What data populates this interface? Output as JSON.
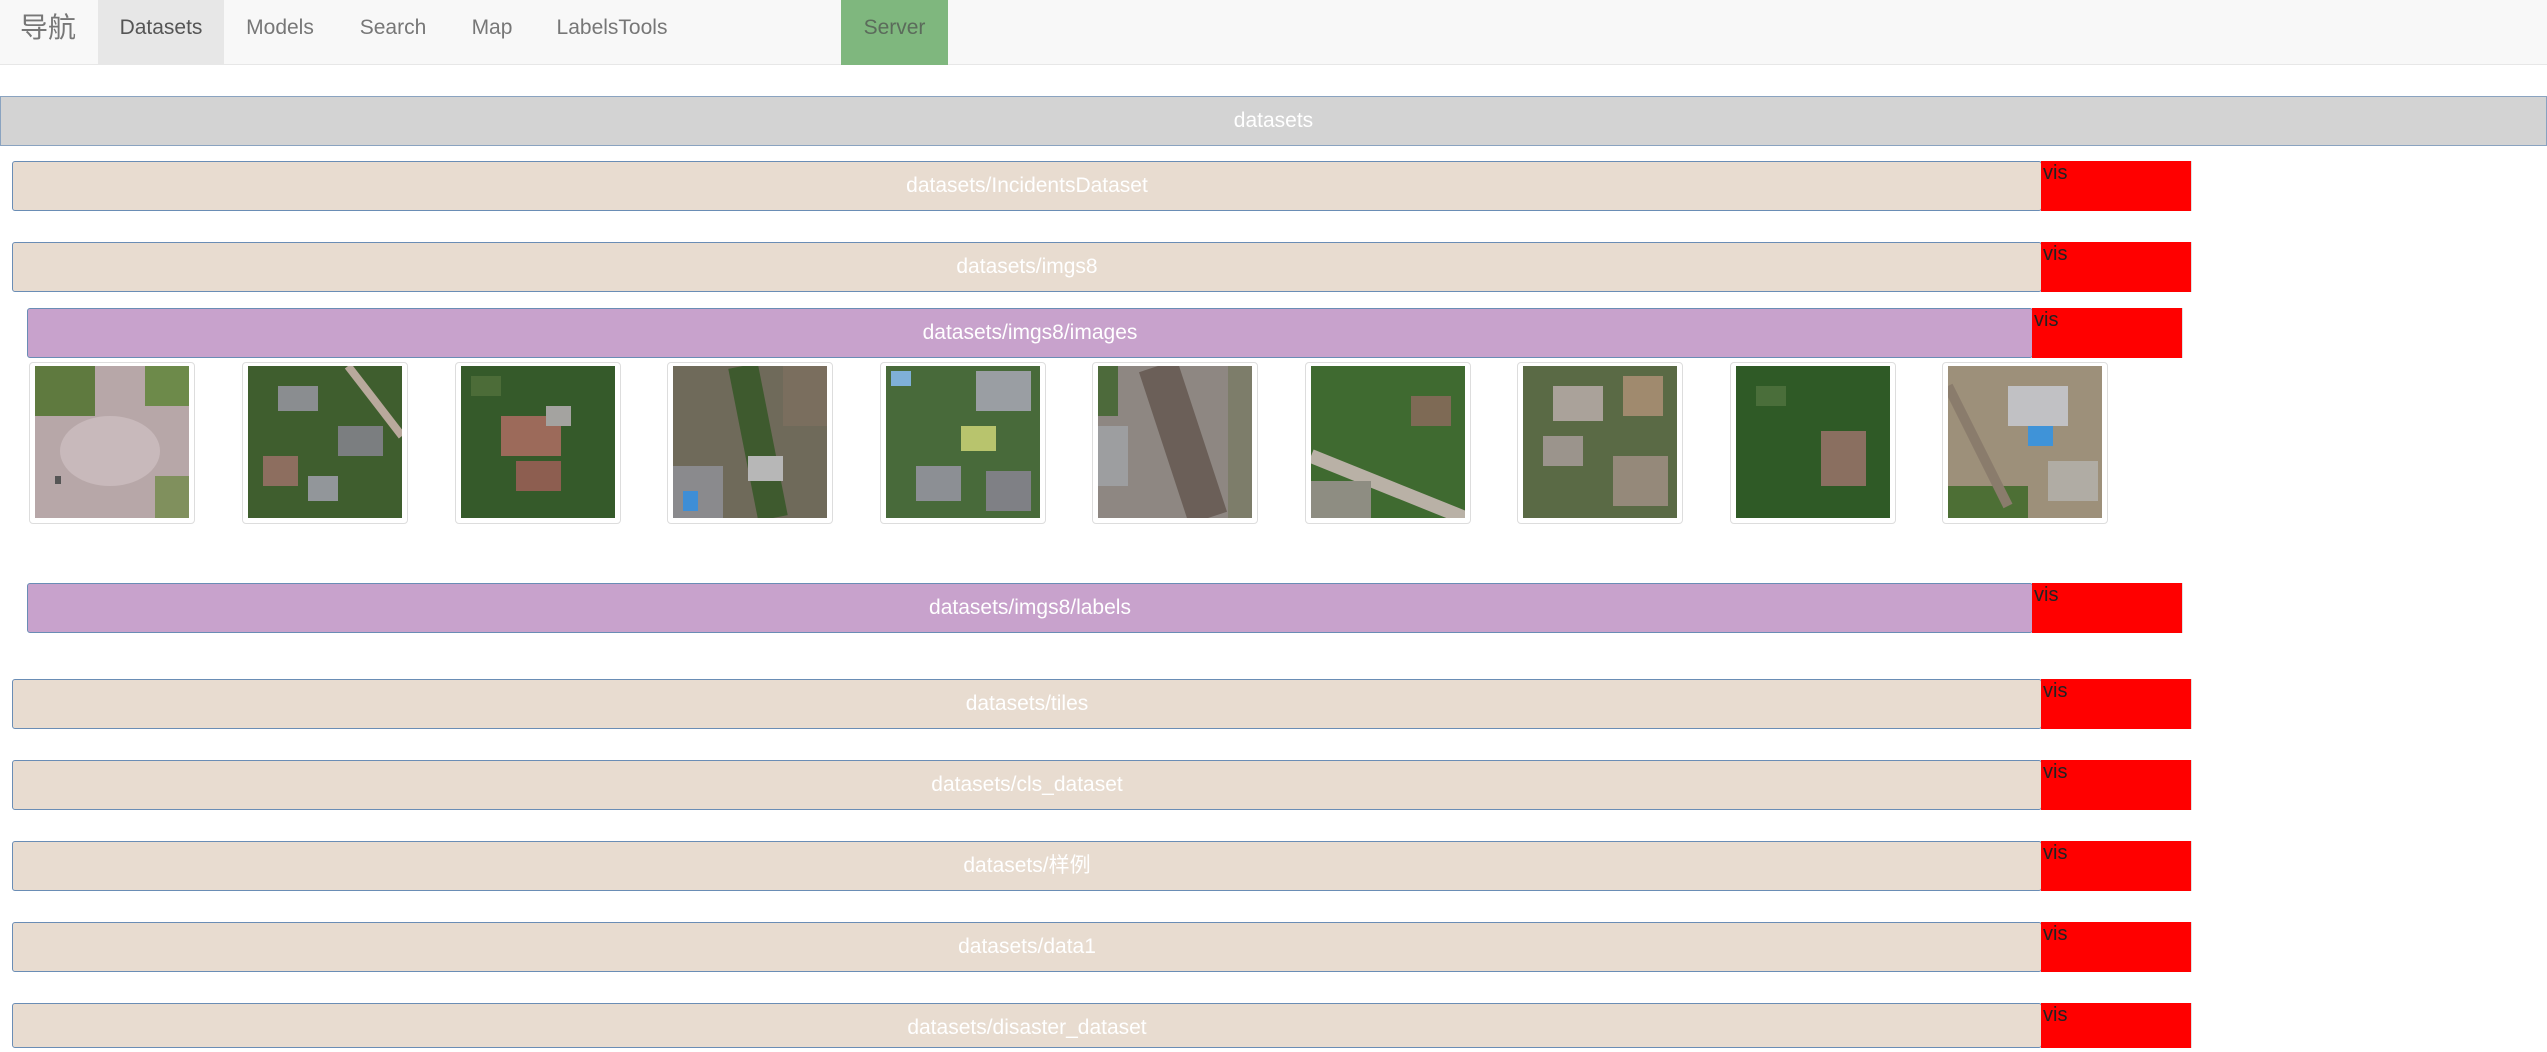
{
  "nav": {
    "brand": "导航",
    "items": [
      {
        "label": "Datasets",
        "active": true
      },
      {
        "label": "Models"
      },
      {
        "label": "Search"
      },
      {
        "label": "Map"
      },
      {
        "label": "LabelsTools"
      }
    ],
    "server_label": "Server"
  },
  "root": {
    "label": "datasets"
  },
  "folders": [
    {
      "label": "datasets/IncidentsDataset",
      "vis": "vis"
    },
    {
      "label": "datasets/imgs8",
      "vis": "vis"
    },
    {
      "label": "datasets/imgs8/images",
      "vis": "vis"
    },
    {
      "label": "datasets/imgs8/labels",
      "vis": "vis"
    },
    {
      "label": "datasets/tiles",
      "vis": "vis"
    },
    {
      "label": "datasets/cls_dataset",
      "vis": "vis"
    },
    {
      "label": "datasets/样例",
      "vis": "vis"
    },
    {
      "label": "datasets/data1",
      "vis": "vis"
    },
    {
      "label": "datasets/disaster_dataset",
      "vis": "vis"
    }
  ],
  "colors": {
    "folder_bg": "#e8dcd0",
    "subfolder_bg": "#c8a2cc",
    "vis_bg": "#ff0000",
    "server_bg": "#7fb77e",
    "root_bg": "#d3d3d3"
  }
}
